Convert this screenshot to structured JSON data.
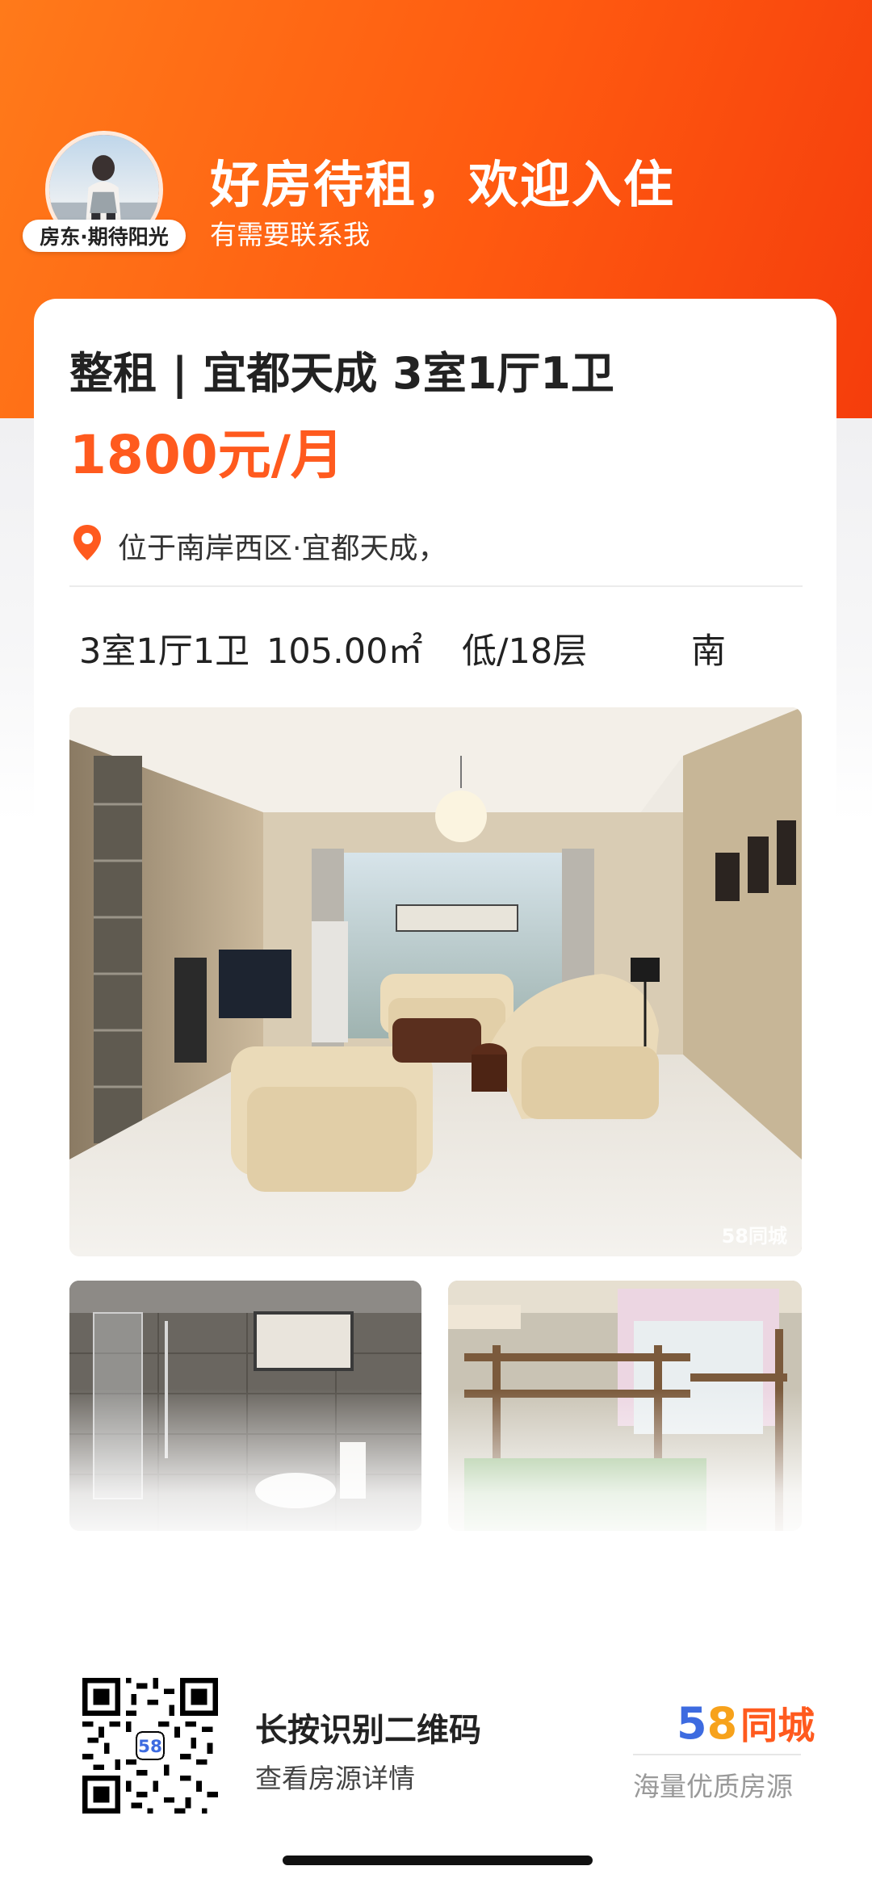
{
  "header": {
    "host_badge": "房东·期待阳光",
    "title": "好房待租，欢迎入住",
    "subtitle": "有需要联系我"
  },
  "listing": {
    "title": "整租 | 宜都天成 3室1厅1卫",
    "price": "1800元/月",
    "location": "位于南岸西区·宜都天成，",
    "specs": {
      "layout": "3室1厅1卫",
      "area": "105.00㎡",
      "floor": "低/18层",
      "orientation": "南"
    },
    "photos": [
      {
        "name": "living-room-photo",
        "watermark": "58同城"
      },
      {
        "name": "bathroom-photo"
      },
      {
        "name": "bedroom-photo"
      }
    ]
  },
  "footer": {
    "qr_title": "长按识别二维码",
    "qr_subtitle": "查看房源详情",
    "brand_5": "5",
    "brand_8": "8",
    "brand_name": "同城",
    "slogan": "海量优质房源"
  },
  "icons": [
    "location-pin-icon",
    "qr-code-icon"
  ],
  "colors": {
    "header_orange": "#ff5a10",
    "price_orange": "#ff5a1e",
    "brand_blue": "#3d6be0",
    "brand_yellow": "#f7a21b"
  }
}
